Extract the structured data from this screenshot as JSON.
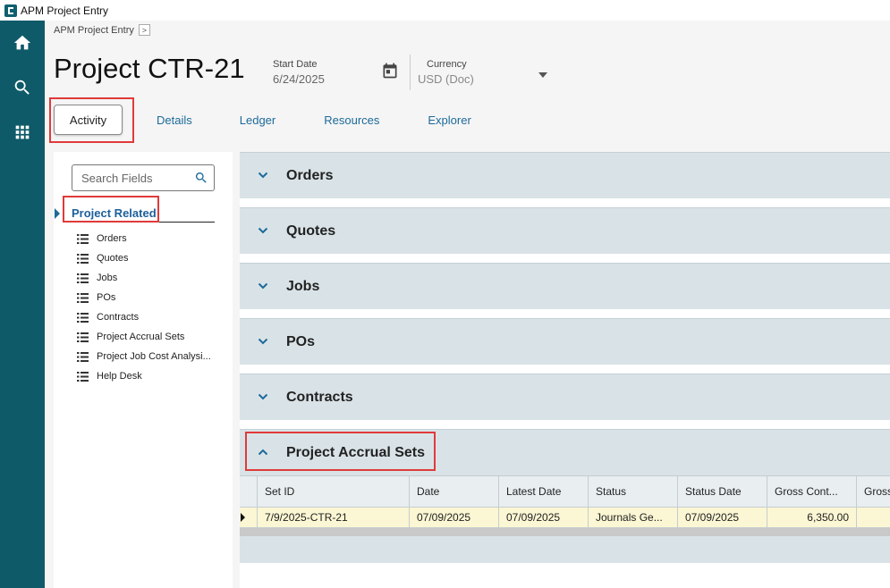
{
  "window": {
    "title": "APM Project Entry"
  },
  "breadcrumb": {
    "label": "APM Project Entry",
    "arrow": ">"
  },
  "project": {
    "title": "Project CTR-21",
    "start_date_label": "Start Date",
    "start_date": "6/24/2025",
    "currency_label": "Currency",
    "currency": "USD (Doc)"
  },
  "tabs": [
    {
      "label": "Activity",
      "active": true
    },
    {
      "label": "Details"
    },
    {
      "label": "Ledger"
    },
    {
      "label": "Resources"
    },
    {
      "label": "Explorer"
    }
  ],
  "fields_pane": {
    "search_placeholder": "Search Fields",
    "group_title": "Project Related",
    "items": [
      "Orders",
      "Quotes",
      "Jobs",
      "POs",
      "Contracts",
      "Project Accrual Sets",
      "Project Job Cost Analysi...",
      "Help Desk"
    ]
  },
  "sections": [
    {
      "title": "Orders",
      "expanded": false
    },
    {
      "title": "Quotes",
      "expanded": false
    },
    {
      "title": "Jobs",
      "expanded": false
    },
    {
      "title": "POs",
      "expanded": false
    },
    {
      "title": "Contracts",
      "expanded": false
    },
    {
      "title": "Project Accrual Sets",
      "expanded": true
    }
  ],
  "accrual_grid": {
    "columns": [
      "Set ID",
      "Date",
      "Latest Date",
      "Status",
      "Status Date",
      "Gross Cont...",
      "Gross"
    ],
    "rows": [
      [
        "7/9/2025-CTR-21",
        "07/09/2025",
        "07/09/2025",
        "Journals Ge...",
        "07/09/2025",
        "6,350.00",
        ""
      ]
    ]
  },
  "colors": {
    "rail": "#0e5a68",
    "accent": "#1c6a9a",
    "highlight": "#e03a3a",
    "section_bg": "#d9e3e7"
  }
}
